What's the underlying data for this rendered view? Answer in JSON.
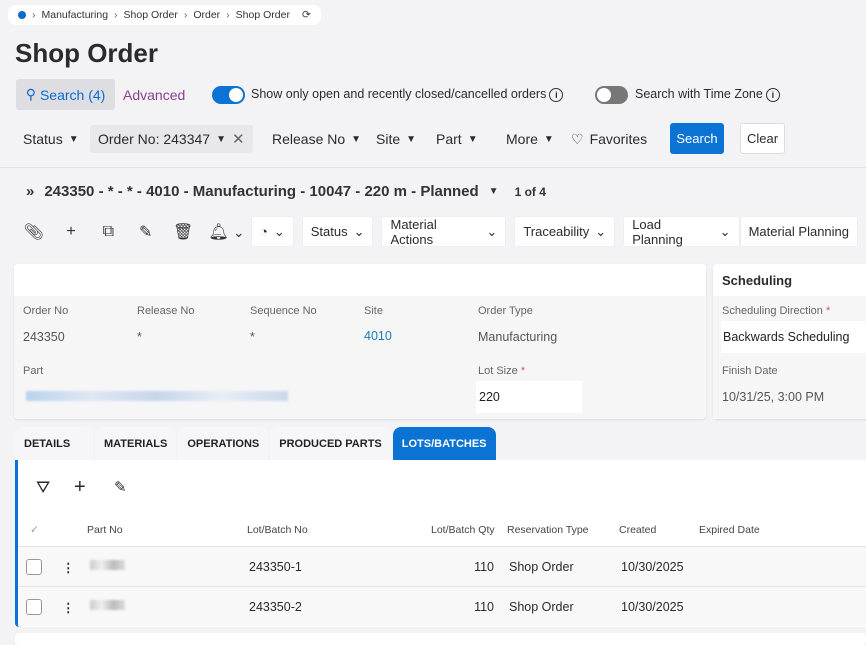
{
  "breadcrumb": [
    "Manufacturing",
    "Shop Order",
    "Order",
    "Shop Order"
  ],
  "page_title": "Shop Order",
  "search": {
    "label": "Search (4)",
    "advanced": "Advanced",
    "toggle_open_label": "Show only open and recently closed/cancelled orders",
    "toggle_open_on": true,
    "toggle_tz_label": "Search with Time Zone",
    "toggle_tz_on": false
  },
  "filters": {
    "status": "Status",
    "order_no": "Order No: 243347",
    "release_no": "Release No",
    "site": "Site",
    "part": "Part",
    "more": "More",
    "favorites": "Favorites",
    "search_btn": "Search",
    "clear_btn": "Clear"
  },
  "record": {
    "title": "243350 - * - * - 4010 - Manufacturing - 10047 - 220 m - Planned",
    "count": "1 of 4"
  },
  "toolbar": {
    "status": "Status",
    "material_actions": "Material Actions",
    "traceability": "Traceability",
    "load_planning": "Load Planning",
    "material_planning": "Material Planning"
  },
  "details": {
    "order_no_label": "Order No",
    "order_no": "243350",
    "release_no_label": "Release No",
    "release_no": "*",
    "sequence_no_label": "Sequence No",
    "sequence_no": "*",
    "site_label": "Site",
    "site": "4010",
    "order_type_label": "Order Type",
    "order_type": "Manufacturing",
    "part_label": "Part",
    "lot_size_label": "Lot Size",
    "lot_size": "220"
  },
  "scheduling": {
    "title": "Scheduling",
    "direction_label": "Scheduling Direction",
    "direction": "Backwards Scheduling",
    "finish_label": "Finish Date",
    "finish": "10/31/25, 3:00 PM"
  },
  "tabs": [
    "DETAILS",
    "MATERIALS",
    "OPERATIONS",
    "PRODUCED PARTS",
    "LOTS/BATCHES"
  ],
  "grid": {
    "headers": [
      "Part No",
      "Lot/Batch No",
      "Lot/Batch Qty",
      "Reservation Type",
      "Created",
      "Expired Date"
    ],
    "rows": [
      {
        "lot": "243350-1",
        "qty": "110",
        "type": "Shop Order",
        "created": "10/30/2025"
      },
      {
        "lot": "243350-2",
        "qty": "110",
        "type": "Shop Order",
        "created": "10/30/2025"
      }
    ]
  }
}
